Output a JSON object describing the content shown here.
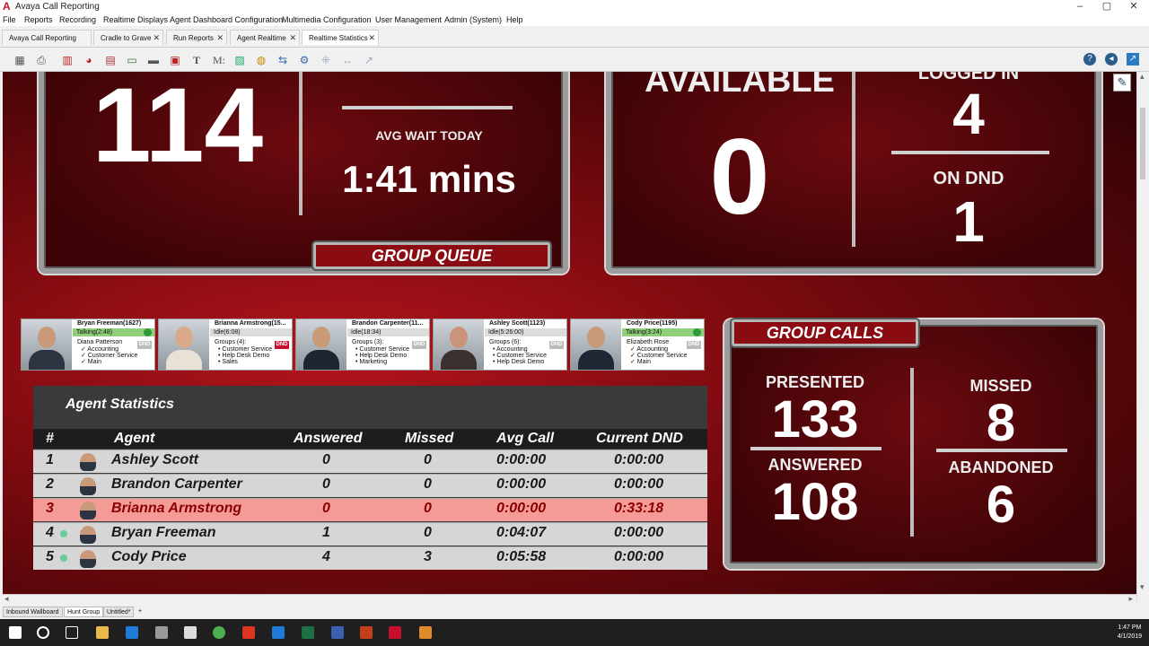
{
  "window": {
    "title": "Avaya Call Reporting",
    "logo": "A",
    "minimize": "–",
    "maximize": "▢",
    "close": "✕"
  },
  "menu": [
    "File",
    "Reports",
    "Recording",
    "Realtime Displays",
    "Agent Dashboard Configuration",
    "Multimedia Configuration",
    "User Management",
    "Admin (System)",
    "Help"
  ],
  "tabs": [
    {
      "label": "Avaya Call Reporting Menu",
      "close": ""
    },
    {
      "label": "Cradle to Grave",
      "close": "✕"
    },
    {
      "label": "Run Reports",
      "close": "✕"
    },
    {
      "label": "Agent Realtime",
      "close": "✕"
    },
    {
      "label": "Realtime Statistics",
      "close": "✕"
    }
  ],
  "toolbar_icons": [
    "save-icon",
    "print-icon",
    "bar-chart-icon",
    "pie-chart-icon",
    "table-icon",
    "gauge-icon",
    "label-icon",
    "date-icon",
    "text-icon",
    "math-icon",
    "image-icon",
    "globe-icon",
    "http-icon",
    "settings-icon",
    "grid-icon",
    "arrows-icon",
    "link-icon"
  ],
  "toolbar_glyphs": [
    "▦",
    "⎙",
    "▥",
    "◕",
    "▤",
    "▭",
    "▬",
    "▣",
    "T",
    "M:",
    "▨",
    "◍",
    "⇆",
    "⚙",
    "⁜",
    "↔",
    "↗"
  ],
  "queue": {
    "calls_waiting": "114",
    "avg_wait_label": "AVG WAIT TODAY",
    "avg_wait_value": "1:41 mins",
    "plate": "GROUP QUEUE"
  },
  "availability": {
    "available_label": "AVAILABLE",
    "available_value": "0",
    "logged_in_label": "LOGGED IN",
    "logged_in_value": "4",
    "dnd_label": "ON DND",
    "dnd_value": "1"
  },
  "agent_cards": [
    {
      "name": "Bryan Freeman(1627)",
      "status": "Talking(2:48)",
      "talking": true,
      "caller": "Diana Patterson",
      "groups": "✓ Accounting\n✓ Customer Service\n✓ Main",
      "dnd": "DND",
      "dnd_on": false,
      "phone": true
    },
    {
      "name": "Brianna Armstrong(15...",
      "status": "Idle(6:08)",
      "talking": false,
      "caller": "Groups (4):",
      "groups": "• Customer Service\n• Help Desk Demo\n• Sales",
      "dnd": "DND",
      "dnd_on": true,
      "phone": false
    },
    {
      "name": "Brandon Carpenter(11...",
      "status": "Idle(18:34)",
      "talking": false,
      "caller": "Groups (3):",
      "groups": "• Customer Service\n• Help Desk Demo\n• Marketing",
      "dnd": "DND",
      "dnd_on": false,
      "phone": false
    },
    {
      "name": "Ashley Scott(1123)",
      "status": "Idle(5:26:00)",
      "talking": false,
      "caller": "Groups (6):",
      "groups": "• Accounting\n• Customer Service\n• Help Desk Demo",
      "dnd": "DND",
      "dnd_on": false,
      "phone": false
    },
    {
      "name": "Cody Price(1195)",
      "status": "Talking(3:24)",
      "talking": true,
      "caller": "Elizabeth Rose",
      "groups": "✓ Accounting\n✓ Customer Service\n✓ Main",
      "dnd": "DND",
      "dnd_on": false,
      "phone": true
    }
  ],
  "agent_stats": {
    "title": "Agent Statistics",
    "columns": [
      "#",
      "Agent",
      "Answered",
      "Missed",
      "Avg Call",
      "Current DND"
    ],
    "rows": [
      {
        "n": "1",
        "agent": "Ashley Scott",
        "answered": "0",
        "missed": "0",
        "avg": "0:00:00",
        "dnd": "0:00:00",
        "alert": false,
        "phone": false
      },
      {
        "n": "2",
        "agent": "Brandon Carpenter",
        "answered": "0",
        "missed": "0",
        "avg": "0:00:00",
        "dnd": "0:00:00",
        "alert": false,
        "phone": false
      },
      {
        "n": "3",
        "agent": "Brianna Armstrong",
        "answered": "0",
        "missed": "0",
        "avg": "0:00:00",
        "dnd": "0:33:18",
        "alert": true,
        "phone": false
      },
      {
        "n": "4",
        "agent": "Bryan Freeman",
        "answered": "1",
        "missed": "0",
        "avg": "0:04:07",
        "dnd": "0:00:00",
        "alert": false,
        "phone": true
      },
      {
        "n": "5",
        "agent": "Cody Price",
        "answered": "4",
        "missed": "3",
        "avg": "0:05:58",
        "dnd": "0:00:00",
        "alert": false,
        "phone": true
      }
    ]
  },
  "group_calls": {
    "plate": "GROUP CALLS",
    "presented_label": "PRESENTED",
    "presented_value": "133",
    "answered_label": "ANSWERED",
    "answered_value": "108",
    "missed_label": "MISSED",
    "missed_value": "8",
    "abandoned_label": "ABANDONED",
    "abandoned_value": "6"
  },
  "sheet_tabs": [
    {
      "label": "Inbound Wallboard",
      "active": false
    },
    {
      "label": "Hunt Group",
      "active": true
    },
    {
      "label": "Untitled*",
      "active": false
    },
    {
      "label": "+",
      "active": false
    }
  ],
  "scroll": {
    "left": "◂",
    "right": "▸",
    "up": "▴",
    "down": "▾"
  },
  "taskbar": {
    "time": "1:47 PM",
    "date": "4/1/2019"
  },
  "colors": {
    "accent_red": "#c8102e",
    "talking_green": "#8fcf7a",
    "alert_row": "#f59b97"
  }
}
